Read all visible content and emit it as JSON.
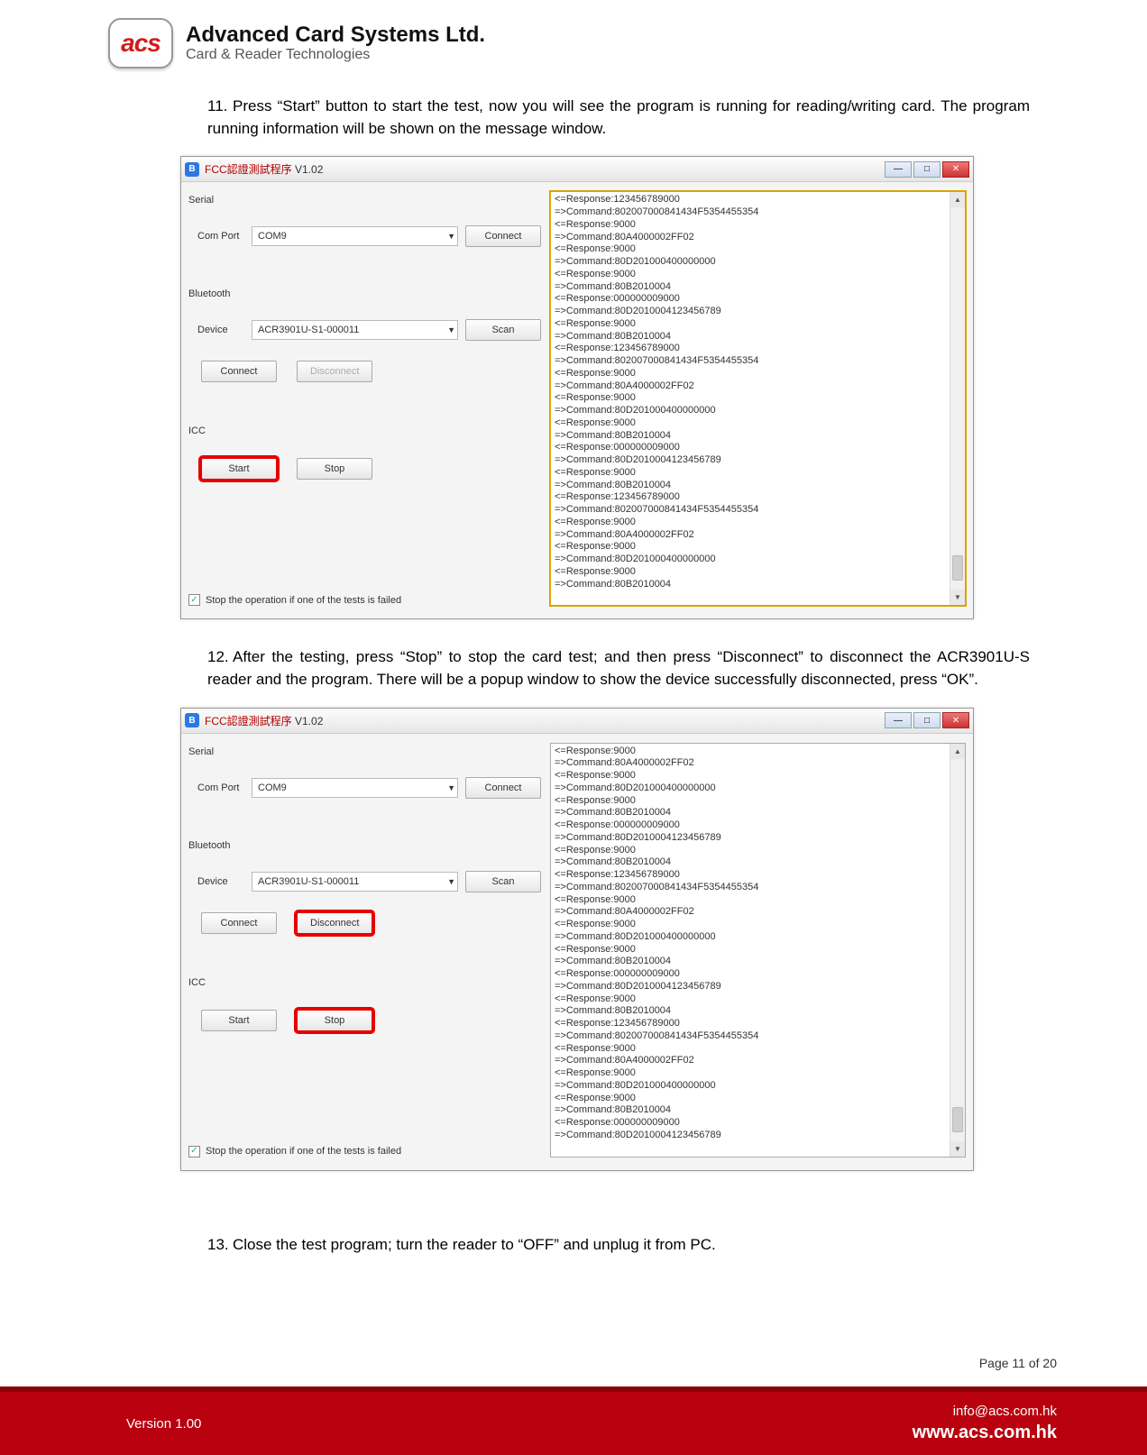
{
  "company": {
    "logo": "acs",
    "name": "Advanced Card Systems Ltd.",
    "sub": "Card & Reader Technologies"
  },
  "steps": {
    "s11": {
      "num": "11.",
      "text": "Press “Start” button to start the test, now you will see the program is running for reading/writing card. The program running information will be shown on the message window."
    },
    "s12": {
      "num": "12.",
      "text": "After the testing, press “Stop” to stop the card test; and then press “Disconnect” to disconnect the ACR3901U-S  reader and the program. There will  be a popup window to show the device successfully disconnected, press “OK”."
    },
    "s13": {
      "num": "13.",
      "text": "Close the test program; turn the reader to “OFF” and unplug it from PC."
    }
  },
  "win": {
    "title_cn": "FCC認證測試程序",
    "title_ver": " V1.02",
    "serial": "Serial",
    "comport": "Com Port",
    "comval": "COM9",
    "connect": "Connect",
    "bluetooth": "Bluetooth",
    "device": "Device",
    "devval": "ACR3901U-S1-000011",
    "scan": "Scan",
    "disconnect": "Disconnect",
    "icc": "ICC",
    "start": "Start",
    "stop": "Stop",
    "checklabel": "Stop the operation if one of the tests is failed"
  },
  "log1": [
    "<=Response:123456789000",
    "=>Command:802007000841434F5354455354",
    "<=Response:9000",
    "=>Command:80A4000002FF02",
    "<=Response:9000",
    "=>Command:80D201000400000000",
    "<=Response:9000",
    "=>Command:80B2010004",
    "<=Response:000000009000",
    "=>Command:80D2010004123456789",
    "<=Response:9000",
    "=>Command:80B2010004",
    "<=Response:123456789000",
    "=>Command:802007000841434F5354455354",
    "<=Response:9000",
    "=>Command:80A4000002FF02",
    "<=Response:9000",
    "=>Command:80D201000400000000",
    "<=Response:9000",
    "=>Command:80B2010004",
    "<=Response:000000009000",
    "=>Command:80D2010004123456789",
    "<=Response:9000",
    "=>Command:80B2010004",
    "<=Response:123456789000",
    "=>Command:802007000841434F5354455354",
    "<=Response:9000",
    "=>Command:80A4000002FF02",
    "<=Response:9000",
    "=>Command:80D201000400000000",
    "<=Response:9000",
    "=>Command:80B2010004"
  ],
  "log2": [
    "<=Response:9000",
    "=>Command:80A4000002FF02",
    "<=Response:9000",
    "=>Command:80D201000400000000",
    "<=Response:9000",
    "=>Command:80B2010004",
    "<=Response:000000009000",
    "=>Command:80D2010004123456789",
    "<=Response:9000",
    "=>Command:80B2010004",
    "<=Response:123456789000",
    "=>Command:802007000841434F5354455354",
    "<=Response:9000",
    "=>Command:80A4000002FF02",
    "<=Response:9000",
    "=>Command:80D201000400000000",
    "<=Response:9000",
    "=>Command:80B2010004",
    "<=Response:000000009000",
    "=>Command:80D2010004123456789",
    "<=Response:9000",
    "=>Command:80B2010004",
    "<=Response:123456789000",
    "=>Command:802007000841434F5354455354",
    "<=Response:9000",
    "=>Command:80A4000002FF02",
    "<=Response:9000",
    "=>Command:80D201000400000000",
    "<=Response:9000",
    "=>Command:80B2010004",
    "<=Response:000000009000",
    "=>Command:80D2010004123456789"
  ],
  "pagenum": "Page 11 of 20",
  "footer": {
    "version": "Version 1.00",
    "email": "info@acs.com.hk",
    "web": "www.acs.com.hk"
  }
}
